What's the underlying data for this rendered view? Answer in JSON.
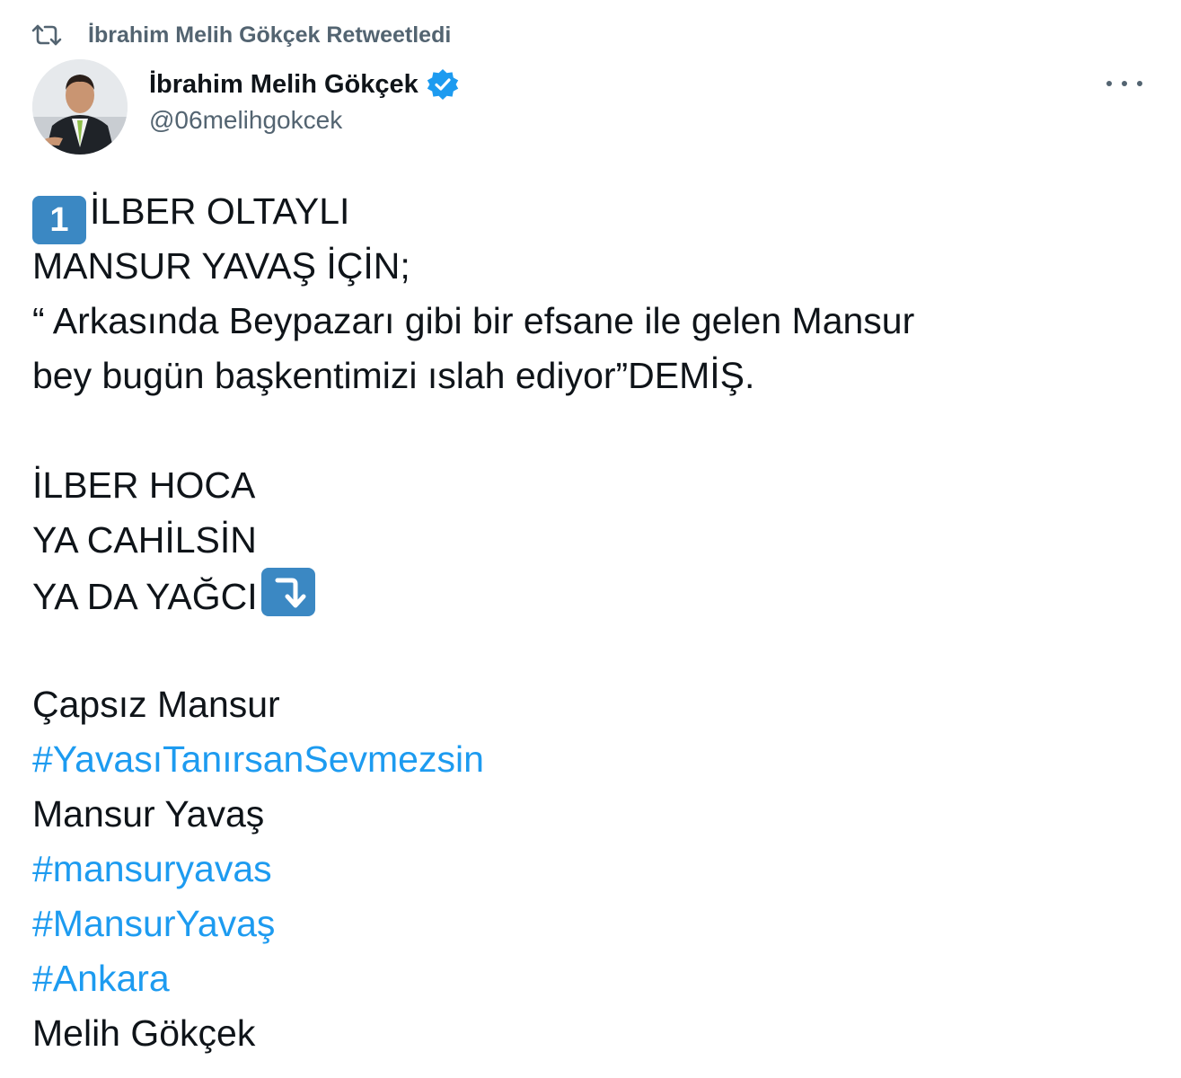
{
  "retweet": {
    "icon": "retweet-icon",
    "text": "İbrahim Melih Gökçek Retweetledi"
  },
  "author": {
    "name": "İbrahim Melih Gökçek",
    "handle": "@06melihgokcek",
    "verified_icon": "verified-badge-icon",
    "avatar": "profile-avatar"
  },
  "more_icon": "more-options-icon",
  "colors": {
    "text": "#0f1419",
    "muted": "#536471",
    "accent": "#1d9bf0",
    "emoji_box": "#3b88c3"
  },
  "tweet": {
    "keycap_emoji": "1",
    "line_1": "İLBER OLTAYLI",
    "line_2": "MANSUR YAVAŞ İÇİN;",
    "line_3": "“ Arkasında Beypazarı gibi bir efsane ile gelen Mansur",
    "line_4": "bey bugün başkentimizi ıslah ediyor”DEMİŞ.",
    "line_5": "İLBER HOCA",
    "line_6": "YA CAHİLSİN",
    "line_7": "YA DA YAĞCI",
    "arrow_emoji": "arrow-down-curved-icon",
    "line_8": "Çapsız Mansur",
    "hashtag_1": "#YavasıTanırsanSevmezsin",
    "line_9": "Mansur Yavaş",
    "hashtag_2": "#mansuryavas",
    "hashtag_3": "#MansurYavaş",
    "hashtag_4": "#Ankara",
    "line_10": "Melih Gökçek"
  }
}
